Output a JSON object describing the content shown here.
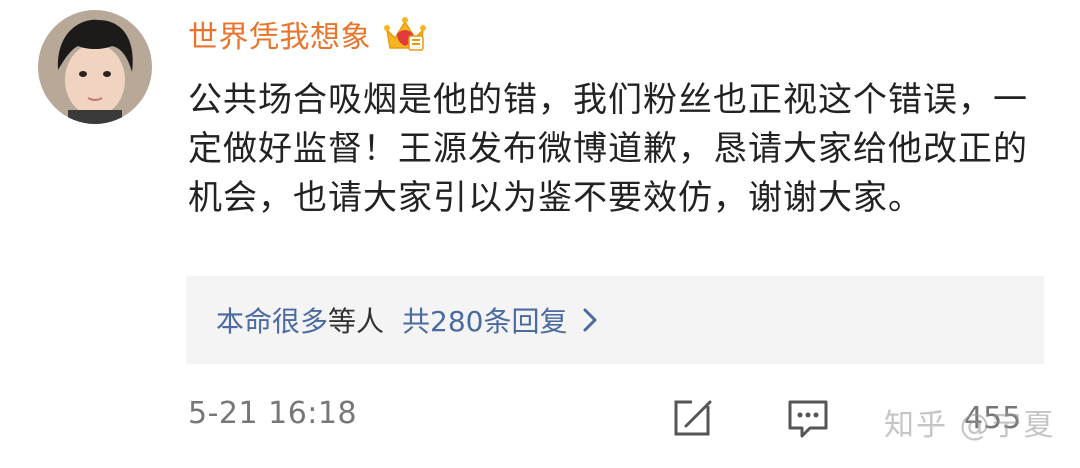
{
  "comment": {
    "username": "世界凭我想象",
    "badge_icon": "crown-vip-icon",
    "content": "公共场合吸烟是他的错，我们粉丝也正视这个错误，一定做好监督！王源发布微博道歉，恳请大家给他改正的机会，也请大家引以为鉴不要效仿，谢谢大家。",
    "replies": {
      "names": "本命很多",
      "deng": "等人",
      "count_label": "共280条回复"
    },
    "timestamp": "5-21 16:18",
    "like_count": "455",
    "watermark": "知乎 @宁夏"
  },
  "colors": {
    "username": "#e8752b",
    "link": "#4a6aa0",
    "meta": "#777777",
    "reply_bg": "#f4f4f4"
  }
}
